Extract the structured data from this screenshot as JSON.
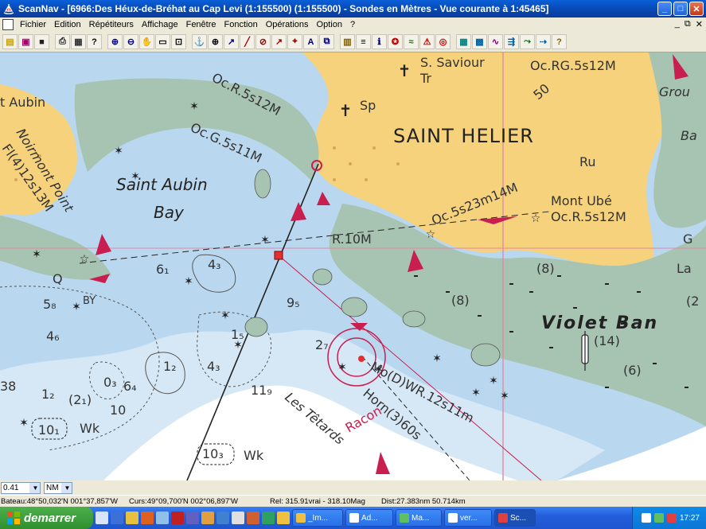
{
  "window": {
    "title": "ScanNav - [6966:Des Héux-de-Bréhat au Cap Levi (1:155500) (1:155500) - Sondes en  Mètres  - Vue courante à 1:45465]",
    "minimize": "_",
    "maximize": "□",
    "close": "✕"
  },
  "menu": {
    "items": [
      "Fichier",
      "Edition",
      "Répétiteurs",
      "Affichage",
      "Fenêtre",
      "Fonction",
      "Opérations",
      "Option",
      "?"
    ],
    "mdi_minimize": "_",
    "mdi_restore": "⧉",
    "mdi_close": "✕"
  },
  "toolbar": {
    "buttons": [
      {
        "icon": "new-icon",
        "glyph": "▤",
        "color": "#c8a000"
      },
      {
        "icon": "open-icon",
        "glyph": "▣",
        "color": "#a0006a"
      },
      {
        "icon": "save-icon",
        "glyph": "■",
        "color": "#222222"
      },
      {
        "icon": "print-icon",
        "glyph": "⎙",
        "color": "#222222"
      },
      {
        "icon": "print-preview-icon",
        "glyph": "▦",
        "color": "#333333"
      },
      {
        "icon": "help-pointer-icon",
        "glyph": "?",
        "color": "#000000"
      },
      {
        "icon": "zoom-in-icon",
        "glyph": "⊕",
        "color": "#000080"
      },
      {
        "icon": "zoom-out-icon",
        "glyph": "⊖",
        "color": "#000080"
      },
      {
        "icon": "pan-hand-icon",
        "glyph": "✋",
        "color": "#000000"
      },
      {
        "icon": "select-rectangle-icon",
        "glyph": "▭",
        "color": "#000000"
      },
      {
        "icon": "select-region-icon",
        "glyph": "⊡",
        "color": "#000000"
      },
      {
        "icon": "anchor-tool-icon",
        "glyph": "⚓",
        "color": "#a00000"
      },
      {
        "icon": "target-icon",
        "glyph": "⊕",
        "color": "#000000"
      },
      {
        "icon": "route-icon",
        "glyph": "↗",
        "color": "#000080"
      },
      {
        "icon": "draw-line-icon",
        "glyph": "╱",
        "color": "#a00000"
      },
      {
        "icon": "ruler-icon",
        "glyph": "⊘",
        "color": "#a00000"
      },
      {
        "icon": "bearing-icon",
        "glyph": "↗",
        "color": "#a00000"
      },
      {
        "icon": "waypoint-icon",
        "glyph": "⌖",
        "color": "#a00000"
      },
      {
        "icon": "text-tool-icon",
        "glyph": "A",
        "color": "#000080"
      },
      {
        "icon": "window-layout-icon",
        "glyph": "⧉",
        "color": "#000080"
      },
      {
        "icon": "gps-device-icon",
        "glyph": "▥",
        "color": "#806000"
      },
      {
        "icon": "nmea-icon",
        "glyph": "≡",
        "color": "#000000"
      },
      {
        "icon": "info-icon",
        "glyph": "ℹ",
        "color": "#000080"
      },
      {
        "icon": "compass-icon",
        "glyph": "✪",
        "color": "#c00000"
      },
      {
        "icon": "wind-icon",
        "glyph": "≈",
        "color": "#008000"
      },
      {
        "icon": "mob-icon",
        "glyph": "⚠",
        "color": "#c00000"
      },
      {
        "icon": "lifebuoy-icon",
        "glyph": "◎",
        "color": "#c00000"
      },
      {
        "icon": "chart-grid-icon",
        "glyph": "▦",
        "color": "#008080"
      },
      {
        "icon": "weather-map-icon",
        "glyph": "▩",
        "color": "#0060a0"
      },
      {
        "icon": "tide-curve-icon",
        "glyph": "∿",
        "color": "#800080"
      },
      {
        "icon": "current-icon",
        "glyph": "⇶",
        "color": "#0060a0"
      },
      {
        "icon": "boat-track-icon",
        "glyph": "⤳",
        "color": "#006000"
      },
      {
        "icon": "log-icon",
        "glyph": "⇢",
        "color": "#0060a0"
      },
      {
        "icon": "context-help-icon",
        "glyph": "?",
        "color": "#806000"
      }
    ]
  },
  "chart": {
    "labels": {
      "s_saviour": "S. Saviour",
      "tr": "Tr",
      "sp": "Sp",
      "oc_rg": "Oc.RG.5s12M",
      "grou": "Grou",
      "depth_50": "50",
      "oc_r_top": "Oc.R.5s12M",
      "aubin_nw": "t Aubin",
      "oc_g": "Oc.G.5s11M",
      "saint_helier": "SAINT HELIER",
      "ba": "Ba",
      "ru": "Ru",
      "fl_light": "Fl(4)12s13M",
      "noirmont": "Noirmont Point",
      "saint_aubin": "Saint Aubin",
      "oc_5s23": "Oc.5s23m14M",
      "mont_ube": "Mont Ubé",
      "oc_r_mont": "Oc.R.5s12M",
      "bay": "Bay",
      "r_10m": "R.10M",
      "g_right": "G",
      "la": "La",
      "depth_61": "6₁",
      "depth_43a": "4₃",
      "depth_8a": "(8)",
      "q_light": "Q",
      "by": "BY",
      "depth_58": "5₈",
      "depth_95": "9₅",
      "depth_8b": "(8)",
      "depth_2": "(2",
      "depth_46": "4₆",
      "depth_15": "1₅",
      "violet_bank": "Violet Ban",
      "depth_14": "(14)",
      "depth_27": "2₇",
      "depth_12a": "1₂",
      "depth_43b": "4₃",
      "depth_6": "(6)",
      "depth_38": "38",
      "depth_12b": "1₂",
      "depth_21": "(2₁)",
      "depth_03": "0₃",
      "depth_64": "6₄",
      "depth_119": "11₉",
      "mo_dwr": "Mo(D)WR.12s11m",
      "depth_10": "10",
      "les_tetards": "Les Têtards",
      "horn": "Horn(3)60s",
      "depth_101": "10₁",
      "wk_a": "Wk",
      "racon": "Racon",
      "depth_103": "10₃",
      "wk_b": "Wk"
    }
  },
  "scale": {
    "value": "0.41",
    "unit": "NM"
  },
  "status": {
    "boat": "Bateau:48°50,032'N 001°37,857'W",
    "cursor": "Curs:49°09,700'N 002°06,897'W",
    "bearing": "Rel: 315.91vrai - 318.10Mag",
    "distance": "Dist:27.383nm  50.714km"
  },
  "taskbar": {
    "start": "demarrer",
    "tasks": [
      "_Im...",
      "Ad...",
      "Ma...",
      "ver...",
      "Sc..."
    ],
    "clock": "17:27"
  },
  "colors": {
    "land": "#f6d27c",
    "deep_water": "#ffffff",
    "shallow_water": "#b9d8ef",
    "drying": "#a7c3b1",
    "magenta": "#c81e50",
    "taskbar_blue": "#245edb",
    "start_green": "#2f8f2f"
  }
}
